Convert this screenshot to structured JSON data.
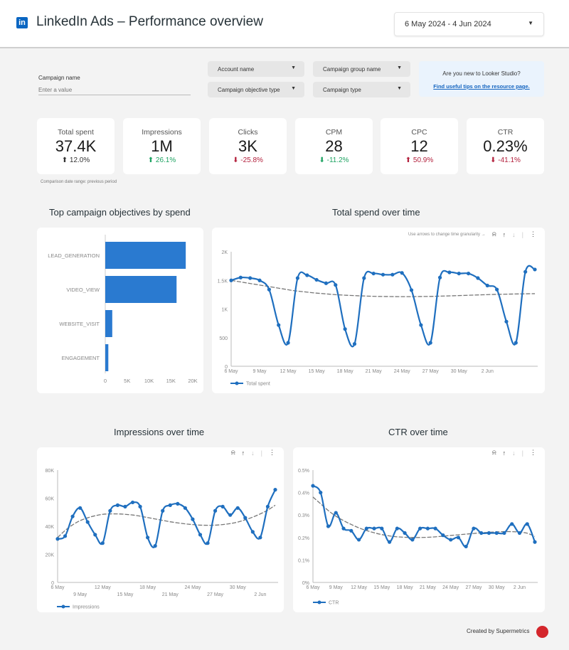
{
  "header": {
    "logo_icon": "linkedin-icon",
    "logo_text": "in",
    "title": "LinkedIn Ads  –  Performance overview",
    "date_range": "6 May 2024 - 4 Jun 2024"
  },
  "filters": {
    "campaign_name_label": "Campaign name",
    "campaign_name_placeholder": "Enter a value",
    "dropdowns": [
      "Account name",
      "Campaign objective type",
      "Campaign group name",
      "Campaign type"
    ]
  },
  "tip": {
    "line1": "Are you new to Looker Studio?",
    "link": "Find useful tips on the resource page."
  },
  "kpis": [
    {
      "label": "Total spent",
      "value": "37.4K",
      "change": "12.0%",
      "dir": "up",
      "color": "#333333"
    },
    {
      "label": "Impressions",
      "value": "1M",
      "change": "26.1%",
      "dir": "up",
      "color": "#1ea362"
    },
    {
      "label": "Clicks",
      "value": "3K",
      "change": "-25.8%",
      "dir": "down",
      "color": "#b3213d"
    },
    {
      "label": "CPM",
      "value": "28",
      "change": "-11.2%",
      "dir": "down",
      "color": "#1ea362"
    },
    {
      "label": "CPC",
      "value": "12",
      "change": "50.9%",
      "dir": "up",
      "color": "#b3213d"
    },
    {
      "label": "CTR",
      "value": "0.23%",
      "change": "-41.1%",
      "dir": "down",
      "color": "#b3213d"
    }
  ],
  "comparison_note": "Comparison date range: previous period",
  "toolbar": {
    "hint": "Use arrows to change time granularity →"
  },
  "footer": {
    "text": "Created by Supermetrics"
  },
  "colors": {
    "series": "#1f6fbf",
    "bar": "#2a7ad0",
    "trend": "#777777"
  },
  "chart_data": [
    {
      "type": "bar",
      "title": "Top campaign objectives by spend",
      "categories": [
        "LEAD_GENERATION",
        "VIDEO_VIEW",
        "WEBSITE_VISIT",
        "ENGAGEMENT"
      ],
      "values": [
        18400,
        16300,
        1600,
        700
      ],
      "xlim": [
        0,
        20000
      ],
      "xticks": [
        "0",
        "5K",
        "10K",
        "15K",
        "20K"
      ],
      "xtick_values": [
        0,
        5000,
        10000,
        15000,
        20000
      ]
    },
    {
      "type": "line",
      "title": "Total spend over time",
      "legend": "Total spent",
      "ylim": [
        0,
        2000
      ],
      "yticks": [
        "0",
        "500",
        "1K",
        "1.5K",
        "2K"
      ],
      "ytick_values": [
        0,
        500,
        1000,
        1500,
        2000
      ],
      "xticks": [
        "6 May",
        "9 May",
        "12 May",
        "15 May",
        "18 May",
        "21 May",
        "24 May",
        "27 May",
        "30 May",
        "2 Jun"
      ],
      "xtick_index": [
        0,
        3,
        6,
        9,
        12,
        15,
        18,
        21,
        24,
        27
      ],
      "values": [
        1500,
        1550,
        1540,
        1500,
        1340,
        720,
        410,
        1540,
        1590,
        1510,
        1450,
        1420,
        650,
        390,
        1540,
        1620,
        1600,
        1600,
        1630,
        1330,
        720,
        410,
        1550,
        1640,
        1620,
        1620,
        1540,
        1410,
        1340,
        780,
        410,
        1650,
        1690
      ],
      "trend": [
        1500,
        1470,
        1440,
        1410,
        1380,
        1350,
        1320,
        1300,
        1280,
        1265,
        1250,
        1240,
        1232,
        1225,
        1220,
        1218,
        1216,
        1216,
        1218,
        1220,
        1225,
        1230,
        1236,
        1242,
        1248,
        1254,
        1258,
        1262,
        1265,
        1268
      ]
    },
    {
      "type": "line",
      "title": "Impressions over time",
      "legend": "Impressions",
      "ylim": [
        0,
        80000
      ],
      "yticks": [
        "0",
        "20K",
        "40K",
        "60K",
        "80K"
      ],
      "ytick_values": [
        0,
        20000,
        40000,
        60000,
        80000
      ],
      "xticks": [
        "6 May",
        "9 May",
        "12 May",
        "15 May",
        "18 May",
        "21 May",
        "24 May",
        "27 May",
        "30 May",
        "2 Jun"
      ],
      "xtick_index": [
        0,
        3,
        6,
        9,
        12,
        15,
        18,
        21,
        24,
        27
      ],
      "values": [
        31000,
        33000,
        47000,
        53000,
        43000,
        34000,
        28000,
        51000,
        55000,
        54000,
        57000,
        54000,
        32000,
        26000,
        51000,
        55000,
        56000,
        53000,
        45000,
        34000,
        28000,
        51000,
        54000,
        48000,
        53000,
        46000,
        36000,
        32000,
        54000,
        66000
      ],
      "trend": [
        32000,
        37000,
        41000,
        44000,
        46000,
        47500,
        48500,
        48800,
        48800,
        48500,
        48000,
        47200,
        46200,
        45200,
        44200,
        43200,
        42400,
        41700,
        41200,
        40800,
        40700,
        40800,
        41200,
        41900,
        43000,
        44600,
        46500,
        48800,
        51500,
        55000
      ]
    },
    {
      "type": "line",
      "title": "CTR over time",
      "legend": "CTR",
      "ylim": [
        0,
        0.5
      ],
      "yticks": [
        "0%",
        "0.1%",
        "0.2%",
        "0.3%",
        "0.4%",
        "0.5%"
      ],
      "ytick_values": [
        0,
        0.1,
        0.2,
        0.3,
        0.4,
        0.5
      ],
      "xticks": [
        "6 May",
        "9 May",
        "12 May",
        "15 May",
        "18 May",
        "21 May",
        "24 May",
        "27 May",
        "30 May",
        "2 Jun"
      ],
      "xtick_index": [
        0,
        3,
        6,
        9,
        12,
        15,
        18,
        21,
        24,
        27
      ],
      "values": [
        0.43,
        0.4,
        0.25,
        0.31,
        0.24,
        0.23,
        0.19,
        0.24,
        0.24,
        0.24,
        0.18,
        0.24,
        0.22,
        0.19,
        0.24,
        0.24,
        0.24,
        0.21,
        0.19,
        0.2,
        0.16,
        0.24,
        0.22,
        0.22,
        0.22,
        0.22,
        0.26,
        0.22,
        0.26,
        0.18
      ],
      "trend": [
        0.38,
        0.35,
        0.32,
        0.295,
        0.275,
        0.258,
        0.243,
        0.231,
        0.221,
        0.213,
        0.207,
        0.203,
        0.201,
        0.2,
        0.2,
        0.201,
        0.203,
        0.206,
        0.209,
        0.212,
        0.215,
        0.218,
        0.221,
        0.223,
        0.225,
        0.226,
        0.226,
        0.224,
        0.219,
        0.205
      ]
    }
  ]
}
